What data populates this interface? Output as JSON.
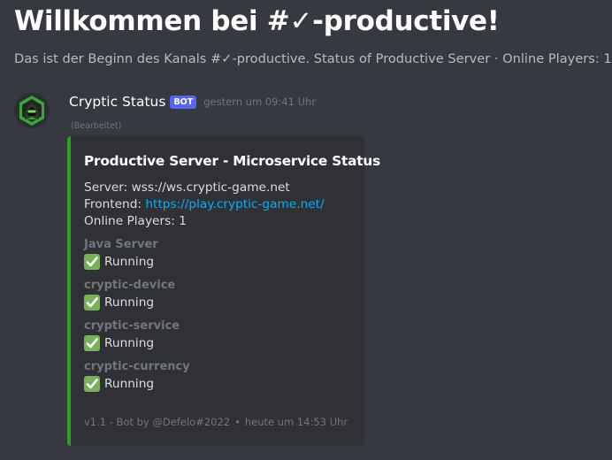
{
  "channel": {
    "title": "Willkommen bei #✓-productive!",
    "description": "Das ist der Beginn des Kanals #✓-productive. Status of Productive Server · Online Players: 1"
  },
  "message": {
    "avatar_icon": "hooded-hacker-logo",
    "username": "Cryptic Status",
    "bot_tag": "BOT",
    "timestamp": "gestern um 09:41 Uhr",
    "edited": "(Bearbeitet)",
    "embed": {
      "color": "#2da01f",
      "title": "Productive Server - Microservice Status",
      "server_label": "Server: wss://ws.cryptic-game.net",
      "frontend_label": "Frontend: ",
      "frontend_link": "https://play.cryptic-game.net/",
      "online_players": "Online Players: 1",
      "fields": [
        {
          "name": "Java Server",
          "value": "Running",
          "icon": "white-check-mark-icon"
        },
        {
          "name": "cryptic-device",
          "value": "Running",
          "icon": "white-check-mark-icon"
        },
        {
          "name": "cryptic-service",
          "value": "Running",
          "icon": "white-check-mark-icon"
        },
        {
          "name": "cryptic-currency",
          "value": "Running",
          "icon": "white-check-mark-icon"
        }
      ],
      "footer_text": "v1.1 - Bot by @Defelo#2022",
      "footer_separator": "•",
      "footer_time": "heute um 14:53 Uhr"
    }
  }
}
